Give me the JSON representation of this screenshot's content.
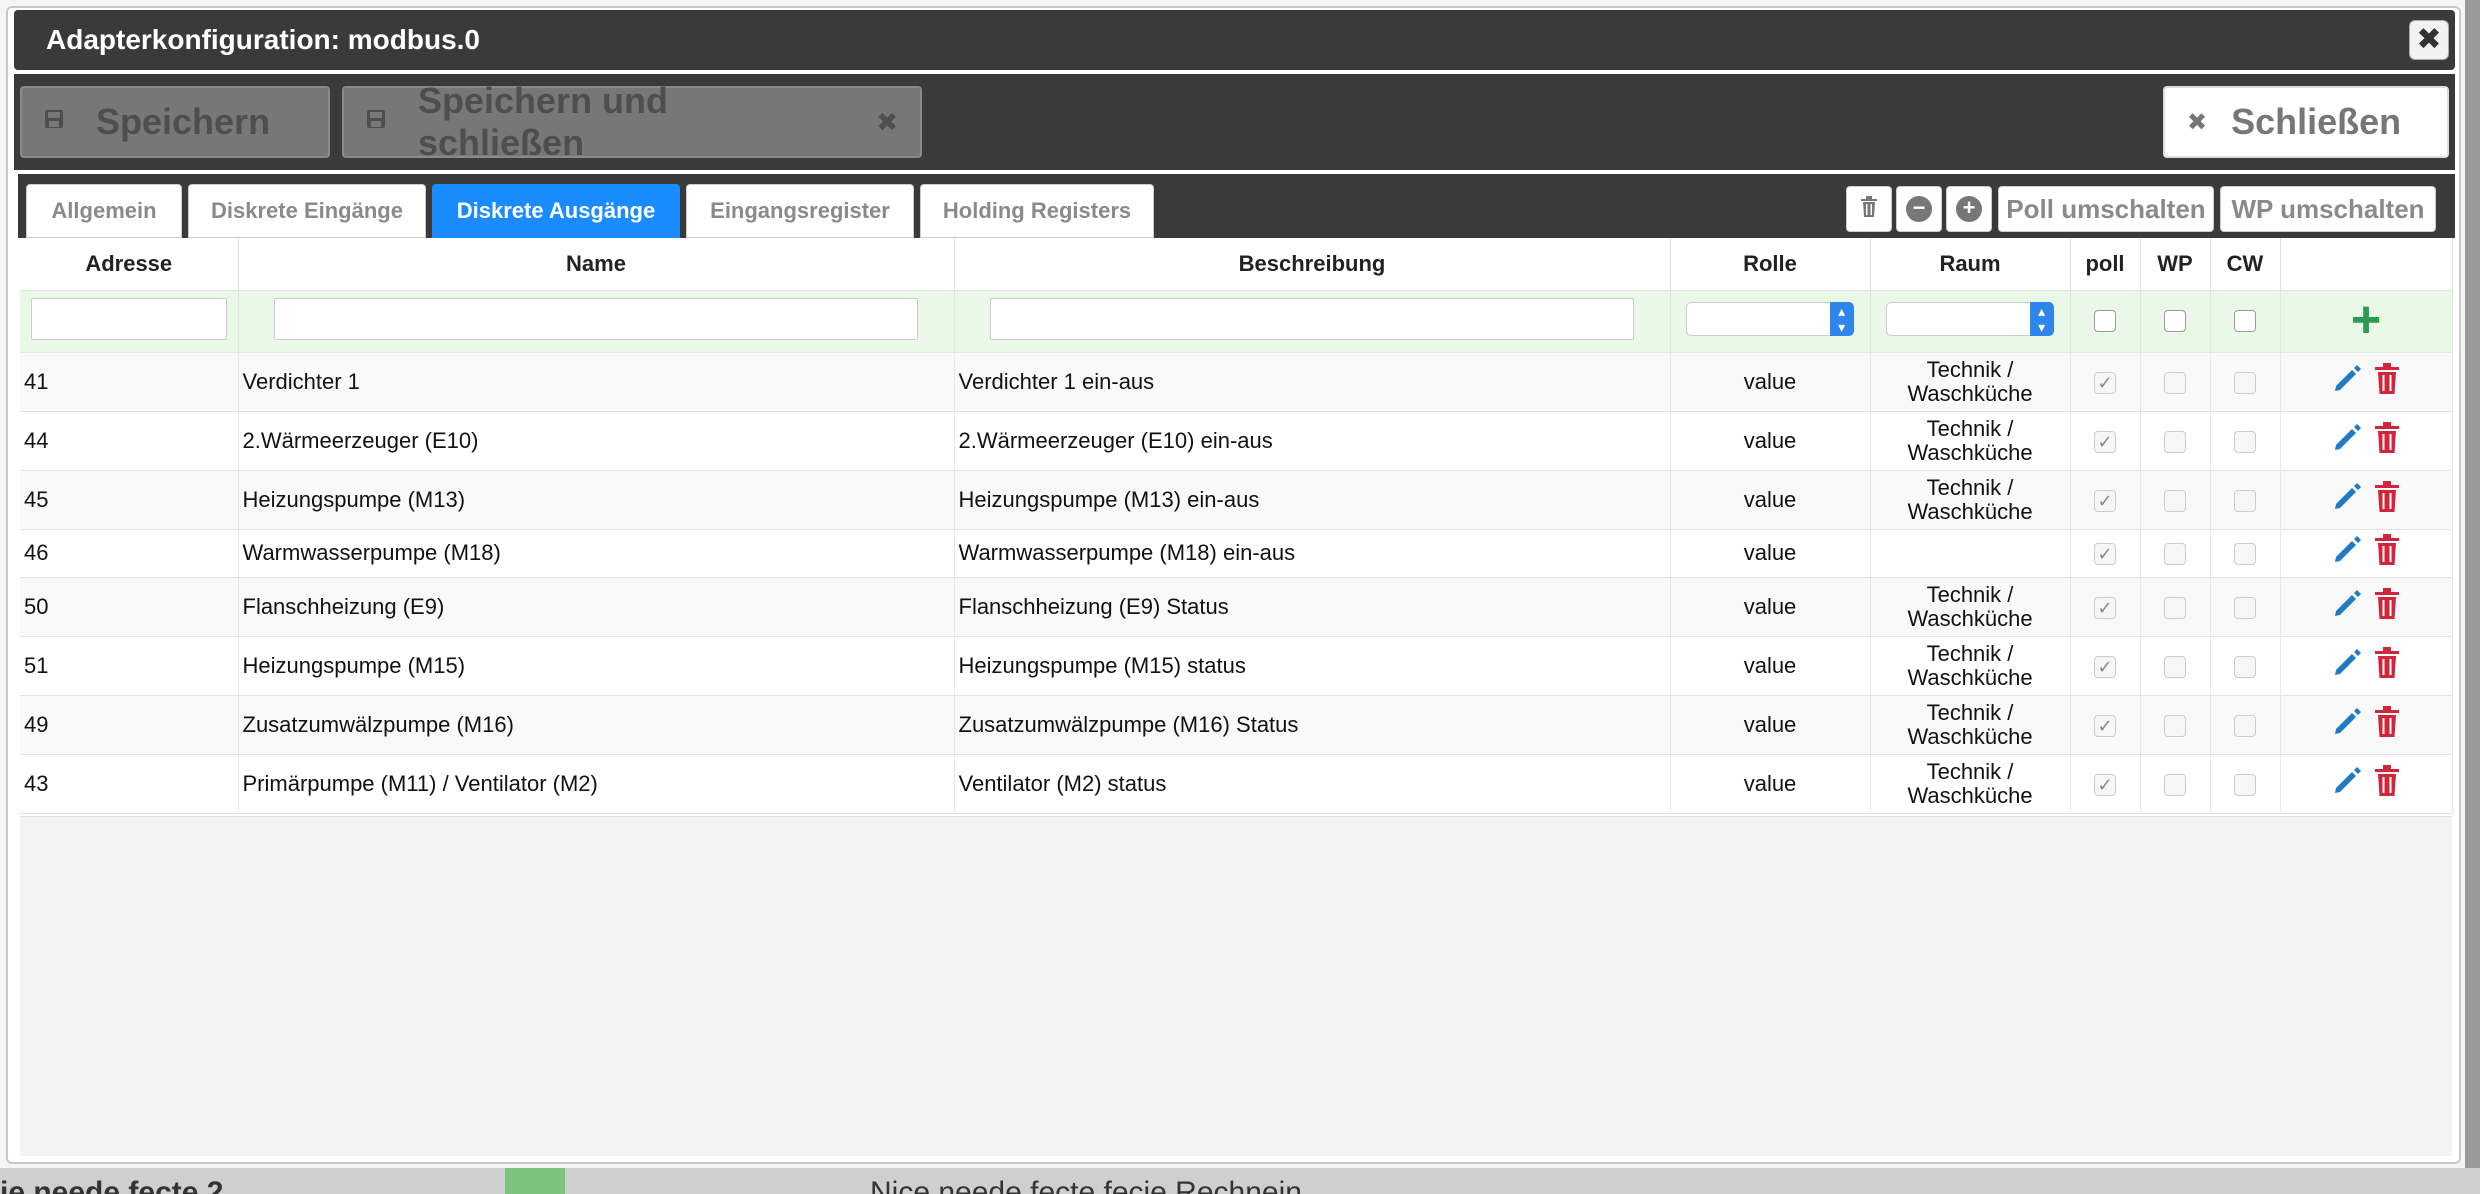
{
  "dialog": {
    "title": "Adapterkonfiguration: modbus.0",
    "close_glyph": "✖"
  },
  "toolbar": {
    "save_label": "Speichern",
    "save_close_label": "Speichern und schließen",
    "close_label": "Schließen"
  },
  "tabs": [
    {
      "label": "Allgemein",
      "active": false
    },
    {
      "label": "Diskrete Eingänge",
      "active": false
    },
    {
      "label": "Diskrete Ausgänge",
      "active": true
    },
    {
      "label": "Eingangsregister",
      "active": false
    },
    {
      "label": "Holding Registers",
      "active": false
    }
  ],
  "tab_tools": {
    "poll_toggle_label": "Poll umschalten",
    "wp_toggle_label": "WP umschalten"
  },
  "table": {
    "headers": [
      "Adresse",
      "Name",
      "Beschreibung",
      "Rolle",
      "Raum",
      "poll",
      "WP",
      "CW"
    ],
    "rows": [
      {
        "address": "41",
        "name": "Verdichter 1",
        "description": "Verdichter 1 ein-aus",
        "role": "value",
        "room1": "Technik /",
        "room2": "Waschküche",
        "poll": true,
        "wp": false,
        "cw": false
      },
      {
        "address": "44",
        "name": "2.Wärmeerzeuger (E10)",
        "description": "2.Wärmeerzeuger (E10) ein-aus",
        "role": "value",
        "room1": "Technik /",
        "room2": "Waschküche",
        "poll": true,
        "wp": false,
        "cw": false
      },
      {
        "address": "45",
        "name": "Heizungspumpe (M13)",
        "description": "Heizungspumpe (M13) ein-aus",
        "role": "value",
        "room1": "Technik /",
        "room2": "Waschküche",
        "poll": true,
        "wp": false,
        "cw": false
      },
      {
        "address": "46",
        "name": "Warmwasserpumpe (M18)",
        "description": "Warmwasserpumpe (M18) ein-aus",
        "role": "value",
        "room1": "",
        "room2": "",
        "poll": true,
        "wp": false,
        "cw": false
      },
      {
        "address": "50",
        "name": "Flanschheizung (E9)",
        "description": "Flanschheizung (E9) Status",
        "role": "value",
        "room1": "Technik /",
        "room2": "Waschküche",
        "poll": true,
        "wp": false,
        "cw": false
      },
      {
        "address": "51",
        "name": "Heizungspumpe (M15)",
        "description": "Heizungspumpe (M15) status",
        "role": "value",
        "room1": "Technik /",
        "room2": "Waschküche",
        "poll": true,
        "wp": false,
        "cw": false
      },
      {
        "address": "49",
        "name": "Zusatzumwälzpumpe (M16)",
        "description": "Zusatzumwälzpumpe (M16) Status",
        "role": "value",
        "room1": "Technik /",
        "room2": "Waschküche",
        "poll": true,
        "wp": false,
        "cw": false
      },
      {
        "address": "43",
        "name": "Primärpumpe (M11) / Ventilator (M2)",
        "description": "Ventilator (M2) status",
        "role": "value",
        "room1": "Technik /",
        "room2": "Waschküche",
        "poll": true,
        "wp": false,
        "cw": false
      }
    ]
  },
  "background": {
    "bottom_left_text": "ie neede fecte 2",
    "bottom_right_text": "Nice neede fecte fecie Rechnein"
  },
  "colors": {
    "accent": "#1a8cff",
    "dark_bar": "#3a3a3a",
    "add_green": "#2d9b4f",
    "delete_red": "#d0253a",
    "edit_blue": "#1f7bc4"
  }
}
